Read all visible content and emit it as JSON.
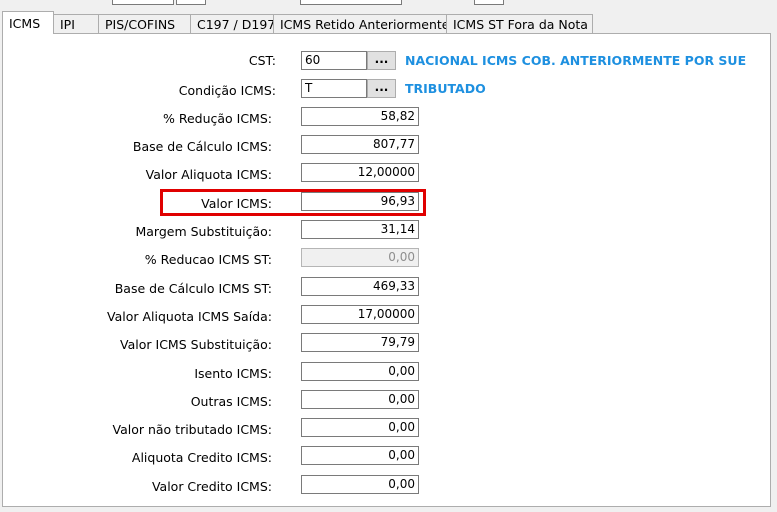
{
  "tabs": [
    {
      "label": "ICMS",
      "active": true
    },
    {
      "label": "IPI",
      "active": false
    },
    {
      "label": "PIS/COFINS",
      "active": false
    },
    {
      "label": "C197 / D197",
      "active": false
    },
    {
      "label": "ICMS Retido Anteriormente",
      "active": false
    },
    {
      "label": "ICMS ST Fora da Nota",
      "active": false
    }
  ],
  "cst": {
    "label": "CST:",
    "value": "60",
    "button": "...",
    "description": "NACIONAL ICMS COB. ANTERIORMENTE POR SUE"
  },
  "condicao": {
    "label": "Condição ICMS:",
    "value": "T",
    "button": "...",
    "description": "TRIBUTADO"
  },
  "fields": [
    {
      "label": "% Redução ICMS:",
      "value": "58,82",
      "enabled": true
    },
    {
      "label": "Base de Cálculo ICMS:",
      "value": "807,77",
      "enabled": true
    },
    {
      "label": "Valor Aliquota ICMS:",
      "value": "12,00000",
      "enabled": true
    },
    {
      "label": "Valor ICMS:",
      "value": "96,93",
      "enabled": true,
      "highlighted": true
    },
    {
      "label": "Margem Substituição:",
      "value": "31,14",
      "enabled": true
    },
    {
      "label": "% Reducao ICMS ST:",
      "value": "0,00",
      "enabled": false
    },
    {
      "label": "Base de Cálculo ICMS ST:",
      "value": "469,33",
      "enabled": true
    },
    {
      "label": "Valor Aliquota ICMS Saída:",
      "value": "17,00000",
      "enabled": true
    },
    {
      "label": "Valor ICMS Substituição:",
      "value": "79,79",
      "enabled": true
    },
    {
      "label": "Isento ICMS:",
      "value": "0,00",
      "enabled": true
    },
    {
      "label": "Outras ICMS:",
      "value": "0,00",
      "enabled": true
    },
    {
      "label": "Valor não tributado ICMS:",
      "value": "0,00",
      "enabled": true
    },
    {
      "label": "Aliquota Credito ICMS:",
      "value": "0,00",
      "enabled": true
    },
    {
      "label": "Valor Credito ICMS:",
      "value": "0,00",
      "enabled": true
    }
  ],
  "colors": {
    "highlight": "#e00000",
    "description": "#1e90e0"
  }
}
